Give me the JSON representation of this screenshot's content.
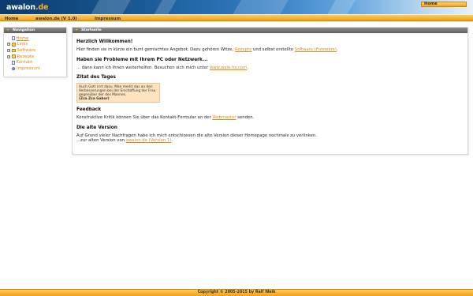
{
  "colors": {
    "accent": "#f2a012",
    "link": "#e08a12",
    "banner": "#1a5a95",
    "box_header": "#6e6e6e",
    "quote_bg": "#fde3c0"
  },
  "banner": {
    "logo_main": "awalon",
    "logo_tld": ".de",
    "home_tab": "Home"
  },
  "navbar": {
    "items": [
      "Home",
      "awalon.de (V 1.0)",
      "Impressum"
    ]
  },
  "sidebar": {
    "title": "Navigation",
    "items": [
      {
        "label": "Home",
        "icon": "page-icon"
      },
      {
        "label": "Links",
        "icon": "folder-icon"
      },
      {
        "label": "Software",
        "icon": "folder-icon"
      },
      {
        "label": "Rezepte",
        "icon": "folder-icon"
      },
      {
        "label": "Kontakt",
        "icon": "page-icon"
      },
      {
        "label": "Impressum",
        "icon": "info-icon"
      }
    ]
  },
  "main": {
    "title": "Startseite",
    "welcome_heading": "Herzlich Willkommen!",
    "welcome_text_1": "Hier finden sie in kürze ein bunt gemischtes Angebot. Dazu gehören Witze, ",
    "welcome_link_1": "Rezepte",
    "welcome_text_2": " und selbst erstellte ",
    "welcome_link_2": "Software (Freeware)",
    "welcome_text_3": ".",
    "problems_heading": "Haben sie Probleme mit Ihrem PC oder Netzwerk...",
    "problems_text": "... dann kann ich ihnen weiterhelfen. Besuchen sich mich unter ",
    "problems_link": "www.weik-hs.com",
    "problems_end": ".",
    "quote_heading": "Zitat des Tages",
    "quote_text": "Auch Gott irrrt dazu. Man merkt das an den Verbesserungen bei der Erschaffung der Frau gegenüber der des Mannes.",
    "quote_author": "(Zsa Zsa Gabor)",
    "feedback_heading": "Feedback",
    "feedback_text_1": "Konstruktive Kritik können Sie über das Kontakt-Formular an der ",
    "feedback_link": "Webmaster",
    "feedback_text_2": " senden.",
    "old_heading": "Die alte Version",
    "old_text_1": "Auf Grund vieler Nachfragen habe ich mich entschlossen die alte Version dieser Homepage nochmals zu verlinken.",
    "old_text_2": "...zur alten Version von ",
    "old_link": "awalon.de (Version 1)",
    "old_end": "."
  },
  "footer": {
    "text": "Copyright © 2005-2015 by Ralf Weik"
  }
}
